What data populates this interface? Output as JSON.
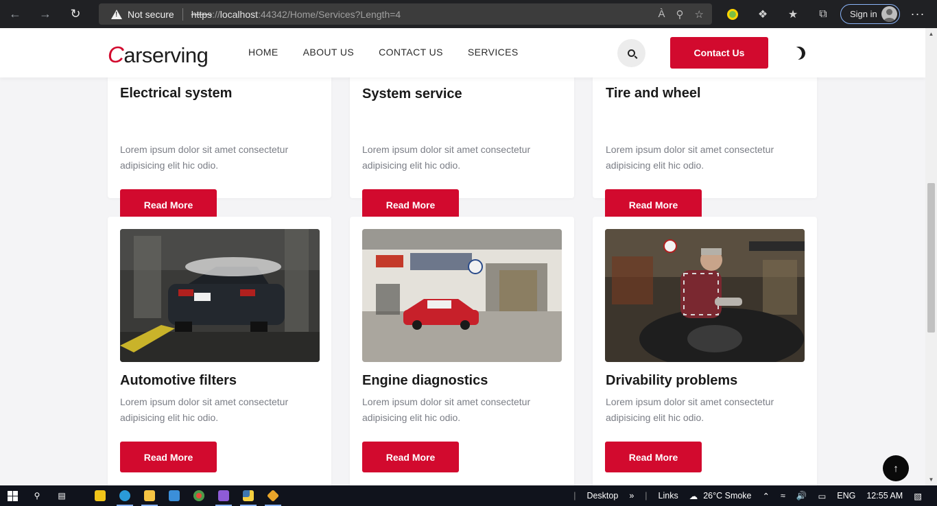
{
  "browser": {
    "security_label": "Not secure",
    "url_scheme": "https",
    "url_sep": "://",
    "url_host": "localhost",
    "url_rest": ":44342/Home/Services?Length=4",
    "signin_label": "Sign in"
  },
  "navbar": {
    "logo_first": "C",
    "logo_rest": "arserving",
    "menu": [
      {
        "label": "HOME"
      },
      {
        "label": "ABOUT US"
      },
      {
        "label": "CONTACT US"
      },
      {
        "label": "SERVICES"
      }
    ],
    "contact_label": "Contact Us"
  },
  "services": [
    {
      "title": "Electrical system",
      "text": "Lorem ipsum dolor sit amet consectetur adipisicing elit hic odio.",
      "button": "Read More"
    },
    {
      "title": "System service",
      "text": "Lorem ipsum dolor sit amet consectetur adipisicing elit hic odio.",
      "button": "Read More"
    },
    {
      "title": "Tire and wheel",
      "text": "Lorem ipsum dolor sit amet consectetur adipisicing elit hic odio.",
      "button": "Read More"
    },
    {
      "title": "Automotive filters",
      "text": "Lorem ipsum dolor sit amet consectetur adipisicing elit hic odio.",
      "button": "Read More"
    },
    {
      "title": "Engine diagnostics",
      "text": "Lorem ipsum dolor sit amet consectetur adipisicing elit hic odio.",
      "button": "Read More"
    },
    {
      "title": "Drivability problems",
      "text": "Lorem ipsum dolor sit amet consectetur adipisicing elit hic odio.",
      "button": "Read More"
    }
  ],
  "colors": {
    "accent": "#d20a2e",
    "page_bg": "#f4f4f6"
  },
  "taskbar": {
    "desktop_label": "Desktop",
    "links_label": "Links",
    "weather": "26°C  Smoke",
    "language": "ENG",
    "time": "12:55 AM"
  }
}
